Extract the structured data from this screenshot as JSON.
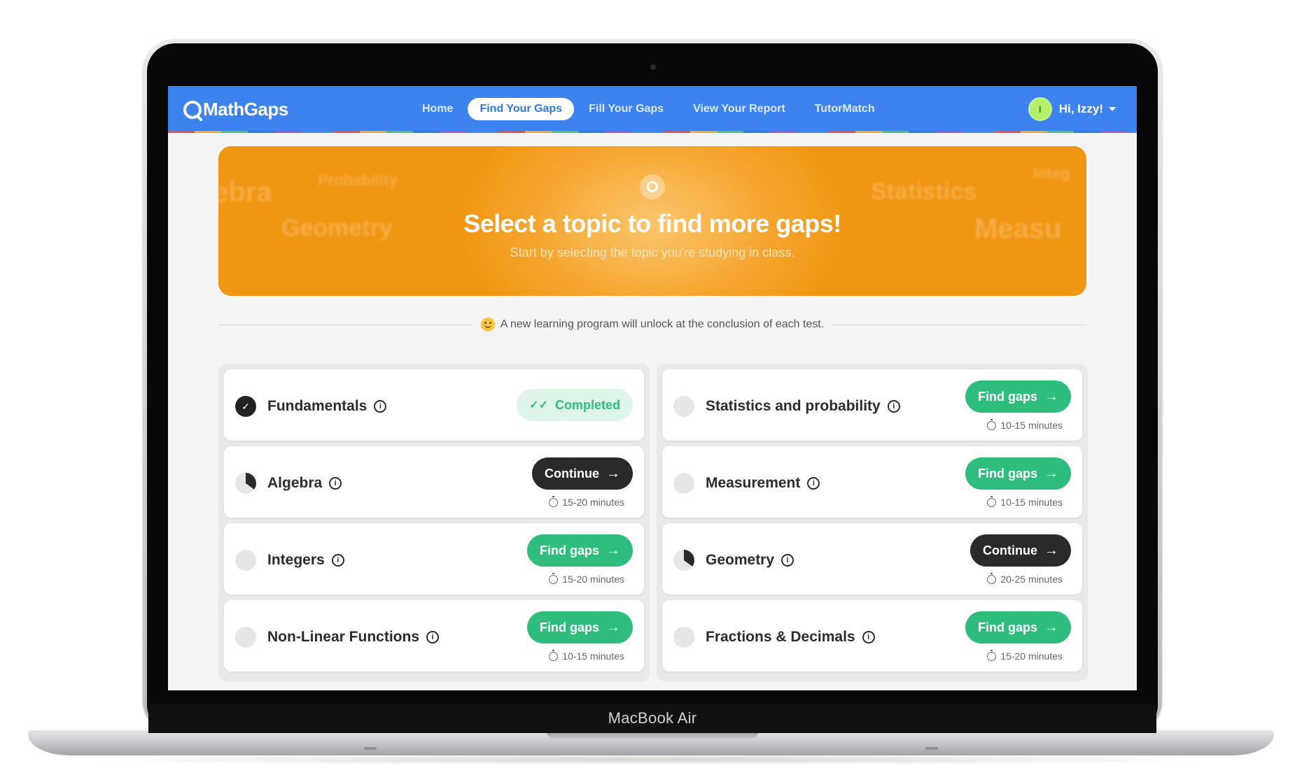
{
  "device": {
    "label": "MacBook Air"
  },
  "nav": {
    "brand": "MathGaps",
    "links": [
      "Home",
      "Find Your Gaps",
      "Fill Your Gaps",
      "View Your Report",
      "TutorMatch"
    ],
    "active_index": 1,
    "user_greeting": "Hi, Izzy!",
    "avatar_initial": "I"
  },
  "hero": {
    "title": "Select a topic to find more gaps!",
    "subtitle": "Start by selecting the topic you're studying in class.",
    "background_words": [
      "ebra",
      "Probability",
      "Geometry",
      "Statistics",
      "Integ",
      "Measu"
    ]
  },
  "notice": {
    "text": "A new learning program will unlock at the conclusion of each test."
  },
  "colors": {
    "primary": "#3d83f0",
    "hero": "#f19612",
    "green": "#2fbd7e",
    "dark": "#2a2a2a"
  },
  "topics": {
    "left": [
      {
        "name": "Fundamentals",
        "status": "completed",
        "badge": "Completed"
      },
      {
        "name": "Algebra",
        "status": "in-progress",
        "action": "Continue",
        "duration": "15-20 minutes"
      },
      {
        "name": "Integers",
        "status": "not-started",
        "action": "Find gaps",
        "duration": "15-20 minutes"
      },
      {
        "name": "Non-Linear Functions",
        "status": "not-started",
        "action": "Find gaps",
        "duration": "10-15 minutes"
      }
    ],
    "right": [
      {
        "name": "Statistics and probability",
        "status": "not-started",
        "action": "Find gaps",
        "duration": "10-15 minutes"
      },
      {
        "name": "Measurement",
        "status": "not-started",
        "action": "Find gaps",
        "duration": "10-15 minutes"
      },
      {
        "name": "Geometry",
        "status": "in-progress",
        "action": "Continue",
        "duration": "20-25 minutes"
      },
      {
        "name": "Fractions & Decimals",
        "status": "not-started",
        "action": "Find gaps",
        "duration": "15-20 minutes"
      }
    ]
  }
}
